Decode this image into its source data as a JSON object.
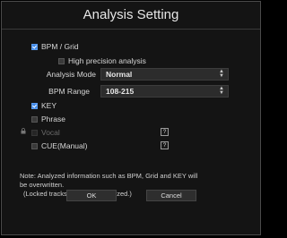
{
  "dialog": {
    "title": "Analysis Setting",
    "bpm_grid_label": "BPM / Grid",
    "high_precision_label": "High precision analysis",
    "analysis_mode_label": "Analysis Mode",
    "analysis_mode_value": "Normal",
    "bpm_range_label": "BPM Range",
    "bpm_range_value": "108-215",
    "key_label": "KEY",
    "phrase_label": "Phrase",
    "vocal_label": "Vocal",
    "cue_label": "CUE(Manual)",
    "help_glyph": "?",
    "note_line1": "Note: Analyzed information such as BPM, Grid and KEY will",
    "note_line2": "be overwritten.",
    "note_line3": "(Locked tracks will not be analyzed.)",
    "ok_label": "OK",
    "cancel_label": "Cancel"
  },
  "state": {
    "bpm_grid_checked": true,
    "high_precision_checked": false,
    "key_checked": true,
    "phrase_checked": false,
    "vocal_checked": false,
    "vocal_disabled": true,
    "cue_checked": false
  },
  "colors": {
    "accent": "#3f88e8",
    "background": "#141414"
  }
}
